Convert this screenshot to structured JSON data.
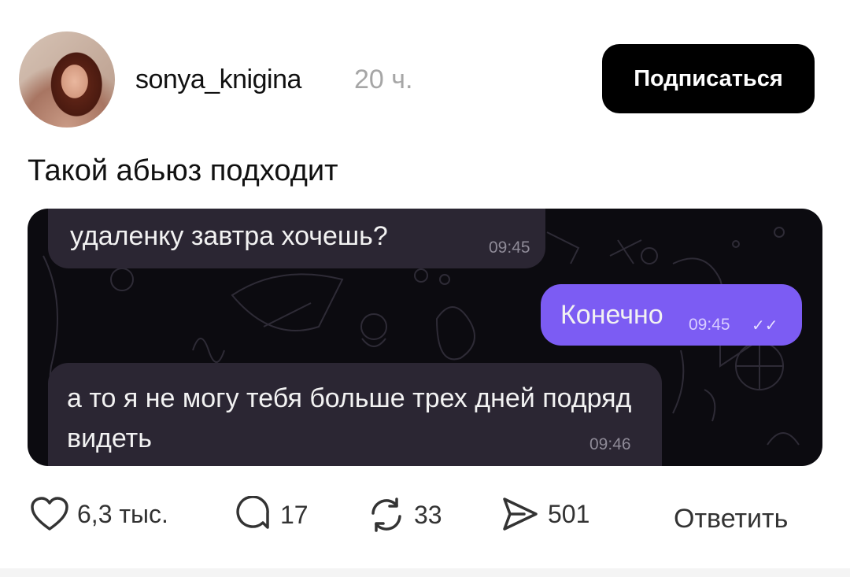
{
  "post": {
    "username": "sonya_knigina",
    "time_ago": "20 ч.",
    "follow_label": "Подписаться",
    "text": "Такой абьюз подходит"
  },
  "chat": {
    "messages": [
      {
        "side": "incoming",
        "text": "удаленку завтра хочешь?",
        "time": "09:45"
      },
      {
        "side": "outgoing",
        "text": "Конечно",
        "time": "09:45",
        "status": "✓✓"
      },
      {
        "side": "incoming",
        "text": "а то я не могу тебя больше трех дней подряд видеть",
        "time": "09:46"
      }
    ],
    "colors": {
      "background": "#0c0b10",
      "incoming": "#2b2633",
      "outgoing": "#7c5cf3"
    }
  },
  "actions": {
    "likes": "6,3 тыс.",
    "comments": "17",
    "reposts": "33",
    "shares": "501",
    "reply_label": "Ответить"
  },
  "icons": [
    "heart-icon",
    "comment-icon",
    "repost-icon",
    "share-icon"
  ]
}
